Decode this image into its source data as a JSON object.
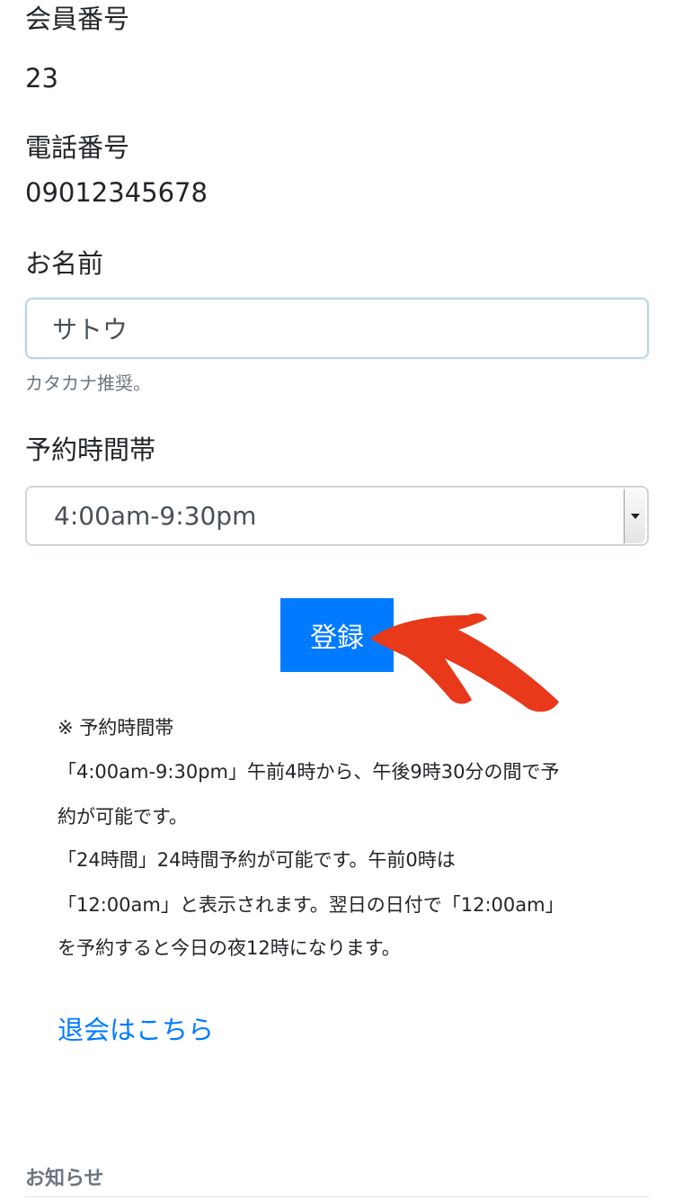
{
  "member": {
    "number_label": "会員番号",
    "number_value": "23",
    "phone_label": "電話番号",
    "phone_value": "09012345678"
  },
  "name_field": {
    "label": "お名前",
    "value": "サトウ",
    "help": "カタカナ推奨。"
  },
  "timeslot": {
    "label": "予約時間帯",
    "selected": "4:00am-9:30pm"
  },
  "submit_label": "登録",
  "notes": [
    "※ 予約時間帯",
    "「4:00am-9:30pm」午前4時から、午後9時30分の間で予",
    "約が可能です。",
    "「24時間」24時間予約が可能です。午前0時は",
    "「12:00am」と表示されます。翌日の日付で「12:00am」",
    "を予約すると今日の夜12時になります。"
  ],
  "withdraw_link": "退会はこちら",
  "notice_heading": "お知らせ",
  "colors": {
    "primary": "#007bff",
    "annotation_arrow": "#e8391a",
    "muted": "#6c757d"
  },
  "icons": {
    "select_arrow": "chevron-down-icon",
    "annotation": "red-arrow-icon"
  }
}
